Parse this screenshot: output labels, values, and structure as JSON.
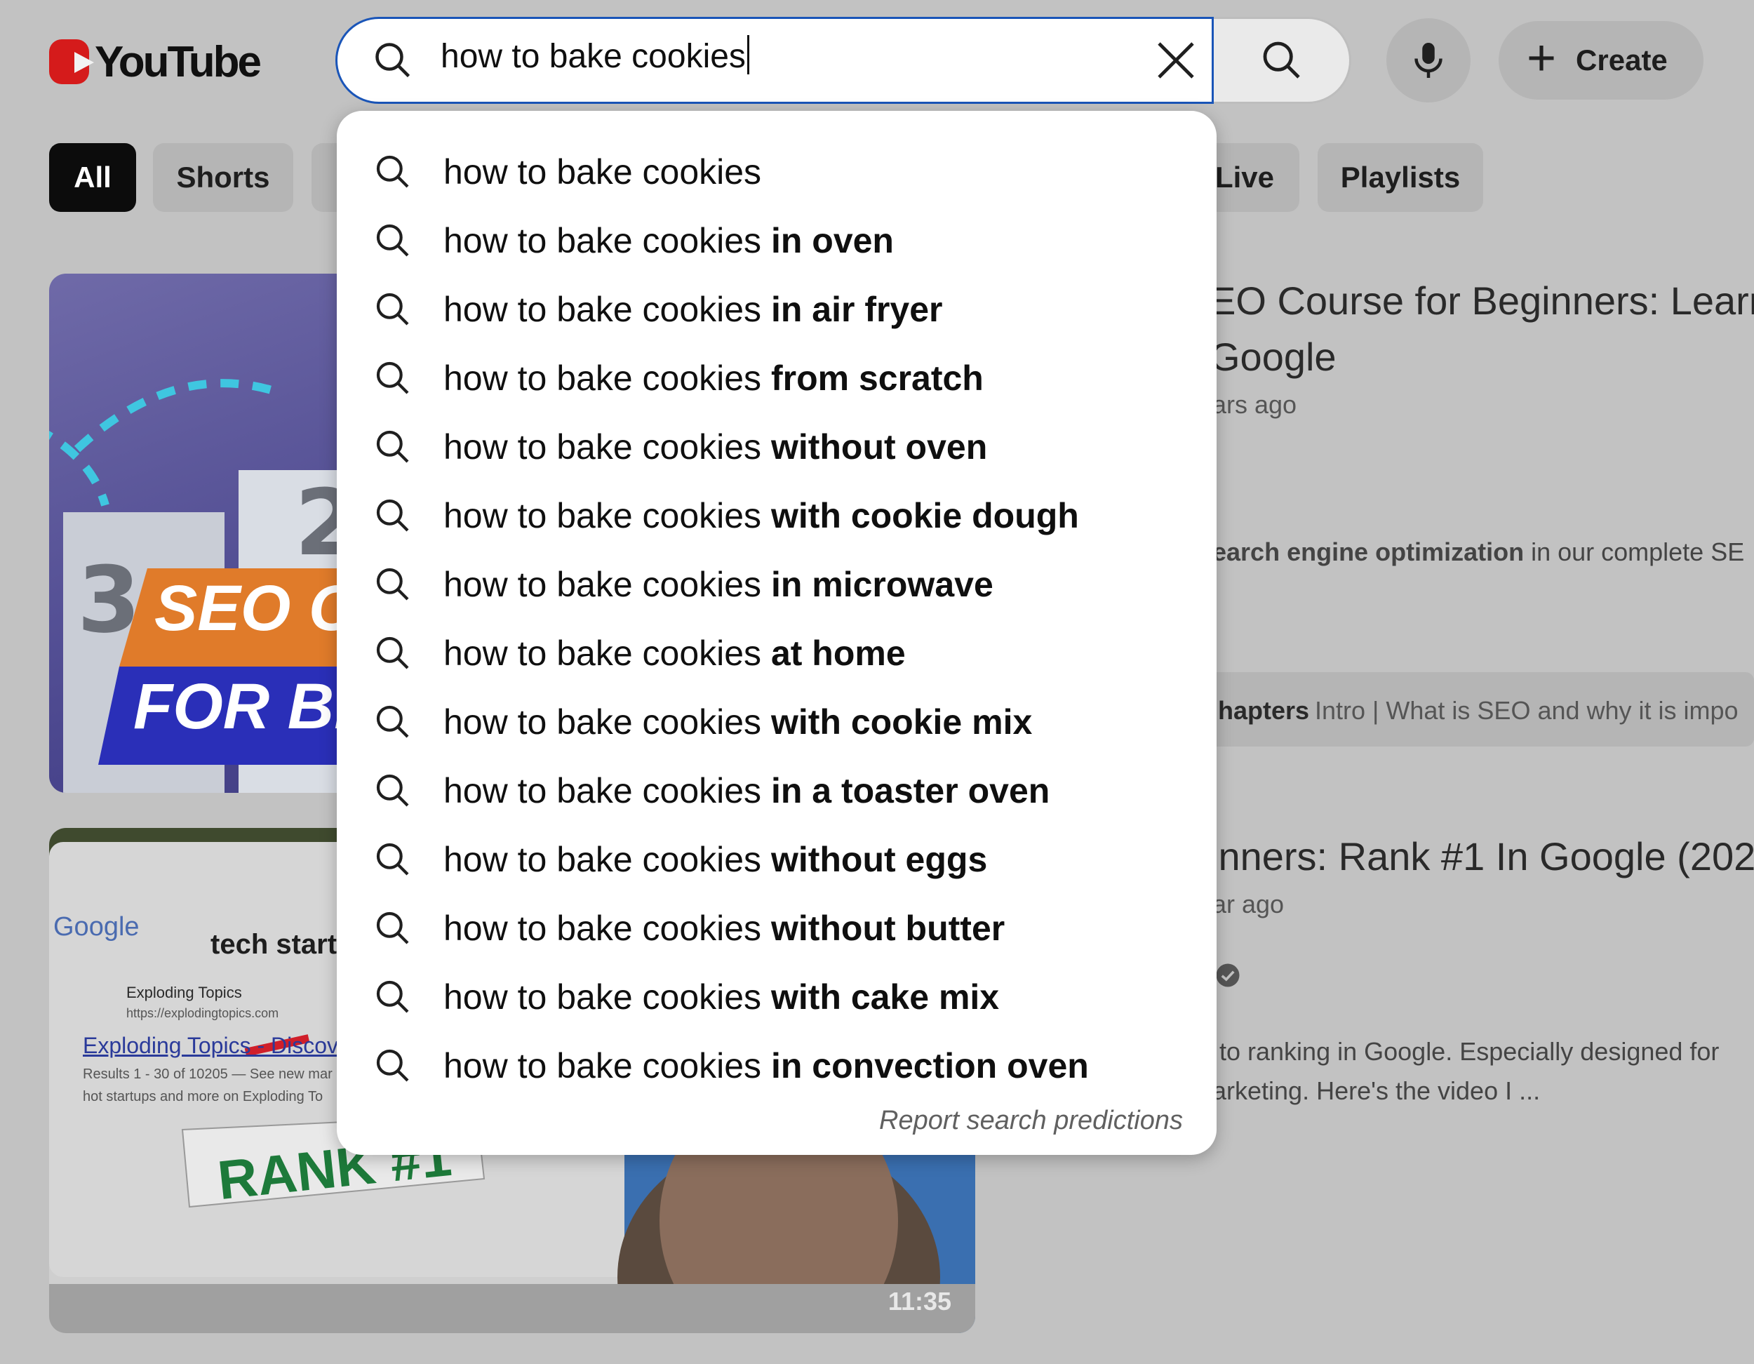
{
  "header": {
    "logo_text": "YouTube",
    "search": {
      "value": "how to bake cookies",
      "clear_icon": "close-icon",
      "search_icon": "search-icon"
    },
    "mic_icon": "microphone-icon",
    "create_label": "Create"
  },
  "filters": [
    {
      "label": "All",
      "active": true
    },
    {
      "label": "Shorts",
      "active": false
    },
    {
      "label": "Live",
      "active": false
    },
    {
      "label": "Playlists",
      "active": false
    }
  ],
  "suggestions": [
    {
      "prefix": "how to bake cookies",
      "completion": ""
    },
    {
      "prefix": "how to bake cookies",
      "completion": " in oven"
    },
    {
      "prefix": "how to bake cookies",
      "completion": " in air fryer"
    },
    {
      "prefix": "how to bake cookies",
      "completion": " from scratch"
    },
    {
      "prefix": "how to bake cookies",
      "completion": " without oven"
    },
    {
      "prefix": "how to bake cookies",
      "completion": " with cookie dough"
    },
    {
      "prefix": "how to bake cookies",
      "completion": " in microwave"
    },
    {
      "prefix": "how to bake cookies",
      "completion": " at home"
    },
    {
      "prefix": "how to bake cookies",
      "completion": " with cookie mix"
    },
    {
      "prefix": "how to bake cookies",
      "completion": " in a toaster oven"
    },
    {
      "prefix": "how to bake cookies",
      "completion": " without eggs"
    },
    {
      "prefix": "how to bake cookies",
      "completion": " without butter"
    },
    {
      "prefix": "how to bake cookies",
      "completion": " with cake mix"
    },
    {
      "prefix": "how to bake cookies",
      "completion": " in convection oven"
    }
  ],
  "report_link": "Report search predictions",
  "results": {
    "first": {
      "title_line1": "EO Course for Beginners: Learn",
      "title_line2": "Google",
      "meta": "ars ago",
      "desc_bold": "earch engine optimization",
      "desc_rest": " in our complete SE",
      "chapters_label": "hapters",
      "chapters_text": "Intro | What is SEO and why it is impo",
      "thumb_text1": "SEO C",
      "thumb_text2": "FOR BE"
    },
    "second": {
      "title": "inners: Rank #1 In Google (202",
      "meta": "ar ago",
      "verified_icon": "verified-check-icon",
      "desc_line1": "to ranking in Google. Especially designed for",
      "desc_line2": "arketing. Here's the video I ...",
      "duration": "11:35",
      "thumb_google": "Google",
      "thumb_search": "tech start",
      "thumb_site": "Exploding Topics",
      "thumb_url": "https://explodingtopics.com",
      "thumb_link": "Exploding Topics - Discover",
      "thumb_results": "Results 1 - 30 of 10205 — See new mar",
      "thumb_snippet": "hot startups and more on Exploding To",
      "thumb_rank": "RANK #1"
    }
  },
  "colors": {
    "overlay_bg": "#c2c2c2",
    "search_border": "#1a55b8",
    "youtube_red": "#d51b1b"
  }
}
